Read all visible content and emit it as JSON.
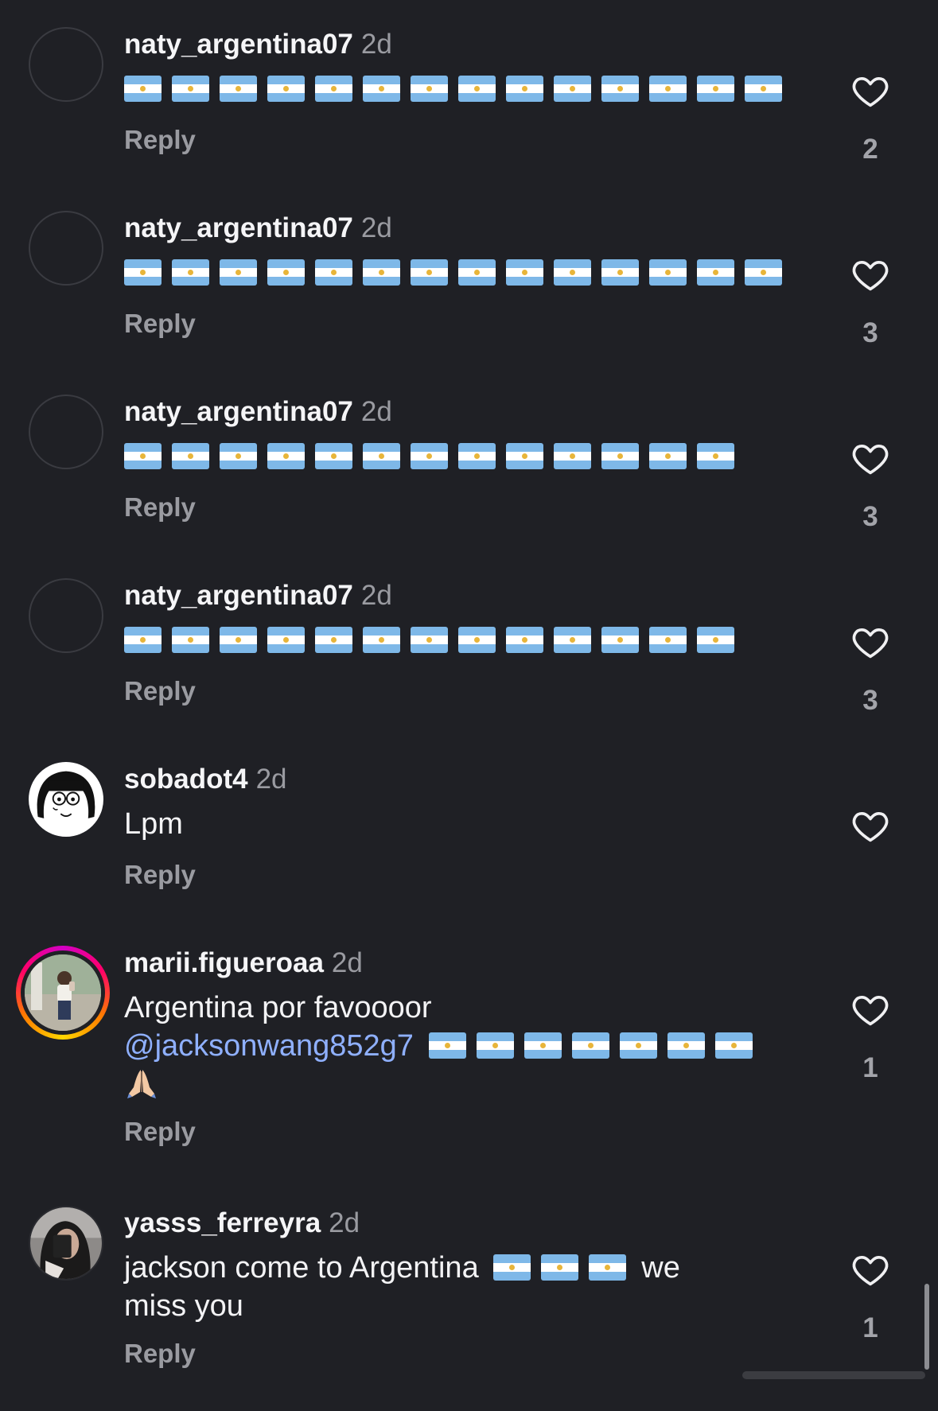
{
  "comments": [
    {
      "username": "naty_argentina07",
      "time": "2d",
      "flags": 14,
      "reply_label": "Reply",
      "likes": "2"
    },
    {
      "username": "naty_argentina07",
      "time": "2d",
      "flags": 14,
      "reply_label": "Reply",
      "likes": "3"
    },
    {
      "username": "naty_argentina07",
      "time": "2d",
      "flags": 13,
      "reply_label": "Reply",
      "likes": "3"
    },
    {
      "username": "naty_argentina07",
      "time": "2d",
      "flags": 13,
      "reply_label": "Reply",
      "likes": "3"
    },
    {
      "username": "sobadot4",
      "time": "2d",
      "text": "Lpm",
      "reply_label": "Reply",
      "likes": ""
    },
    {
      "username": "marii.figueroaa",
      "time": "2d",
      "text": "Argentina por favoooor",
      "mention": "@jacksonwang852g7",
      "flags": 7,
      "emoji": "pray-emoji",
      "reply_label": "Reply",
      "likes": "1"
    },
    {
      "username": "yasss_ferreyra",
      "time": "2d",
      "text_before": "jackson come to Argentina",
      "flags": 3,
      "text_after": "we",
      "text_line2": "miss you",
      "reply_label": "Reply",
      "likes": "1"
    }
  ],
  "icons": {
    "like": "heart-outline-icon",
    "flag": "argentina-flag-emoji"
  },
  "colors": {
    "background": "#1f2025",
    "username": "#f5f5f7",
    "meta": "#9a9ba1",
    "mention": "#8fb0ff",
    "story_ring": "#ff0069"
  }
}
